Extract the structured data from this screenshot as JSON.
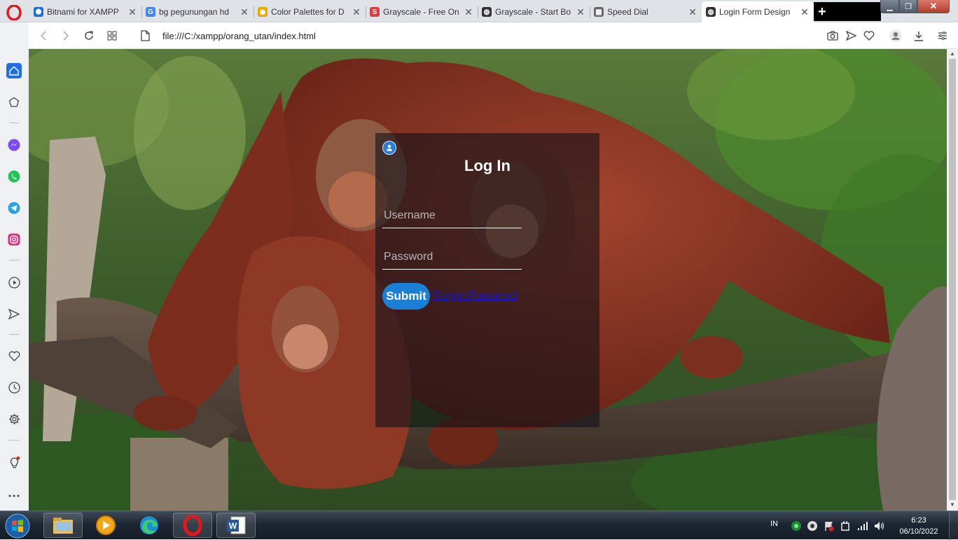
{
  "browser": {
    "tabs": [
      {
        "title": "Bitnami for XAMPP",
        "favicon": "bitnami-icon",
        "color": "#1d6fd3",
        "active": false
      },
      {
        "title": "bg pegunungan hd",
        "favicon": "google-icon",
        "color": "#4285f4",
        "active": false
      },
      {
        "title": "Color Palettes for D",
        "favicon": "palette-icon",
        "color": "#e5a800",
        "active": false
      },
      {
        "title": "Grayscale - Free On",
        "favicon": "startbootstrap-icon",
        "color": "#d8403f",
        "active": false
      },
      {
        "title": "Grayscale - Start Bo",
        "favicon": "globe-icon",
        "color": "#333333",
        "active": false
      },
      {
        "title": "Speed Dial",
        "favicon": "speed-dial-icon",
        "color": "#666666",
        "active": false
      },
      {
        "title": "Login Form Design",
        "favicon": "globe-icon",
        "color": "#333333",
        "active": true
      }
    ],
    "url": "file:///C:/xampp/orang_utan/index.html"
  },
  "page": {
    "login": {
      "title": "Log In",
      "username_placeholder": "Username",
      "password_placeholder": "Password",
      "submit_label": "Submit",
      "forgot_label": "Forgot Password"
    }
  },
  "taskbar": {
    "language": "IN",
    "time": "6:23",
    "date": "06/10/2022"
  },
  "colors": {
    "accent": "#1a7fd6",
    "link": "#1313d8",
    "opera_red": "#e0191c"
  }
}
